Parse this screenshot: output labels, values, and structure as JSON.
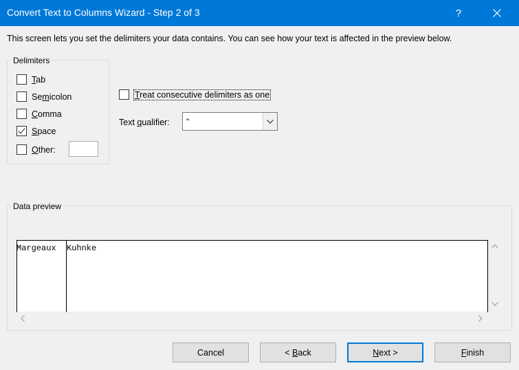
{
  "window": {
    "title": "Convert Text to Columns Wizard - Step 2 of 3",
    "help_label": "?"
  },
  "instructions": "This screen lets you set the delimiters your data contains.  You can see how your text is affected in the preview below.",
  "delimiters": {
    "legend": "Delimiters",
    "items": [
      {
        "key": "T",
        "rest": "ab",
        "checked": false
      },
      {
        "key": "m",
        "pre": "Se",
        "rest": "icolon",
        "checked": false
      },
      {
        "key": "C",
        "rest": "omma",
        "checked": false
      },
      {
        "key": "S",
        "rest": "pace",
        "checked": true
      },
      {
        "key": "O",
        "rest": "ther:",
        "checked": false
      }
    ],
    "other_value": ""
  },
  "consecutive": {
    "key": "T",
    "rest": "reat consecutive delimiters as one",
    "checked": false
  },
  "qualifier": {
    "label_pre": "Text ",
    "label_key": "q",
    "label_rest": "ualifier:",
    "value": "\""
  },
  "preview": {
    "legend": "Data preview",
    "cells": [
      "Margeaux",
      "Kuhnke"
    ]
  },
  "buttons": {
    "cancel": "Cancel",
    "back_pre": "< ",
    "back_key": "B",
    "back_rest": "ack",
    "next_key": "N",
    "next_rest": "ext >",
    "finish_key": "F",
    "finish_rest": "inish"
  }
}
